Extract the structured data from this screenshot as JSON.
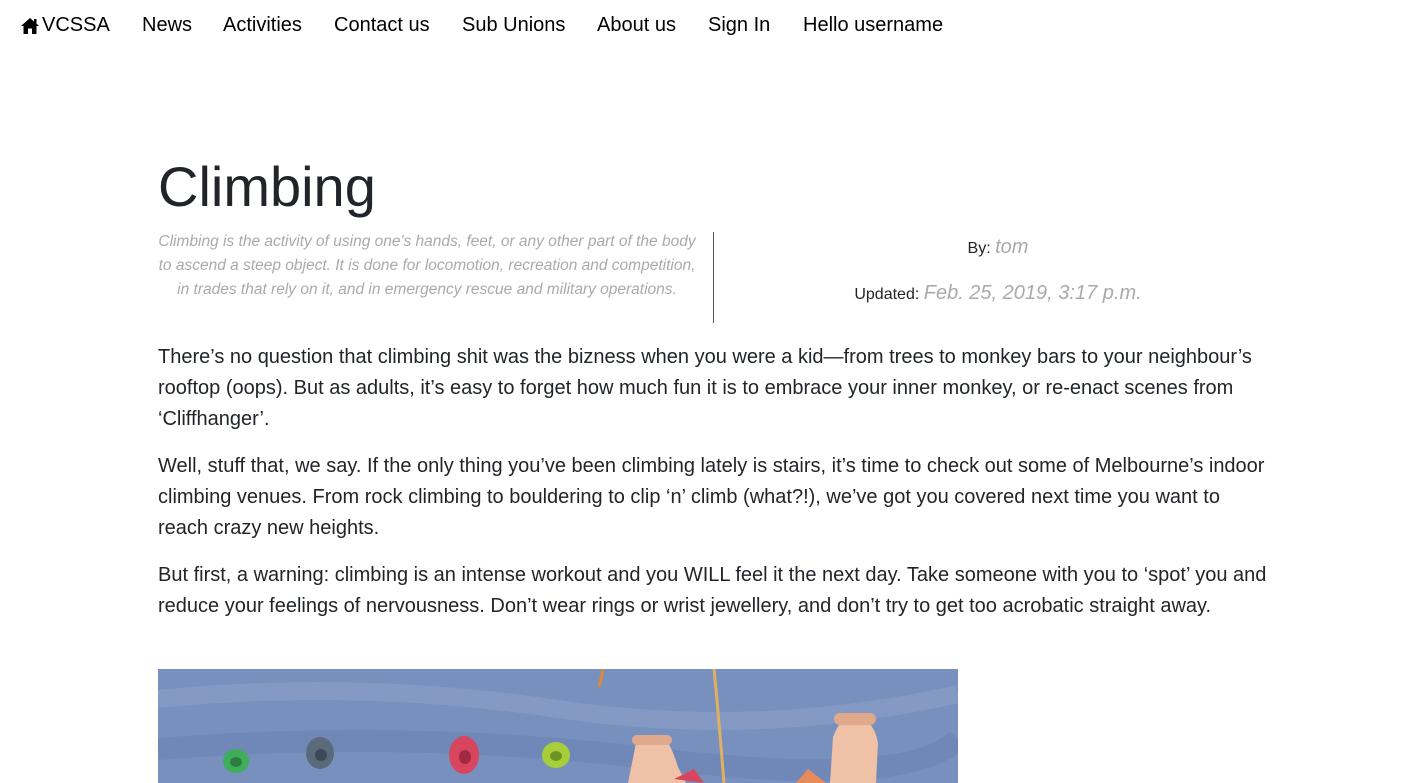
{
  "nav": {
    "brand": "VCSSA",
    "items": [
      {
        "label": "News"
      },
      {
        "label": "Activities"
      },
      {
        "label": "Contact us"
      },
      {
        "label": "Sub Unions"
      },
      {
        "label": "About us"
      },
      {
        "label": "Sign In"
      },
      {
        "label": "Hello username"
      }
    ]
  },
  "article": {
    "title": "Climbing",
    "summary": "Climbing is the activity of using one's hands, feet, or any other part of the body to ascend a steep object. It is done for locomotion, recreation and competition, in trades that rely on it, and in emergency rescue and military operations.",
    "by_label": "By:",
    "author": "tom",
    "updated_label": "Updated:",
    "updated": "Feb. 25, 2019, 3:17 p.m.",
    "paragraphs": [
      "There’s no question that climbing shit was the bizness when you were a kid—from trees to monkey bars to your neighbour’s rooftop (oops). But as adults, it’s easy to forget how much fun it is to embrace your inner monkey, or re-enact scenes from ‘Cliffhanger’.",
      "Well, stuff that, we say. If the only thing you’ve been climbing lately is stairs, it’s time to check out some of Melbourne’s indoor climbing venues. From rock climbing to bouldering to clip ‘n’ climb (what?!), we’ve got you covered next time you want to reach crazy new heights.",
      "But first, a warning: climbing is an intense workout and you WILL feel it the next day. Take someone with you to ‘spot’ you and reduce your feelings of nervousness. Don’t wear rings or wrist jewellery, and don’t try to get too acrobatic straight away."
    ]
  },
  "colors": {
    "wall": "#7f97c3",
    "hold_green": "#3fae5a",
    "hold_red": "#d8455e",
    "hold_lime": "#a6cf3a",
    "hold_grey": "#5a6a7a",
    "rope": "#e0b060",
    "skin": "#efc1a6"
  }
}
